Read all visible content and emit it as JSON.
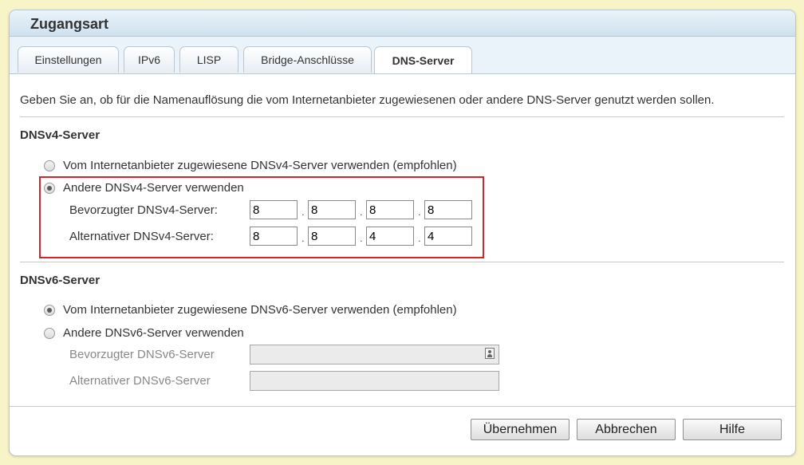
{
  "panel": {
    "title": "Zugangsart"
  },
  "tabs": [
    {
      "label": "Einstellungen",
      "active": false
    },
    {
      "label": "IPv6",
      "active": false
    },
    {
      "label": "LISP",
      "active": false
    },
    {
      "label": "Bridge-Anschlüsse",
      "active": false
    },
    {
      "label": "DNS-Server",
      "active": true
    }
  ],
  "intro": "Geben Sie an, ob für die Namenauflösung die vom Internetanbieter zugewiesenen oder andere DNS-Server genutzt werden sollen.",
  "dnsv4": {
    "title": "DNSv4-Server",
    "option_isp": "Vom Internetanbieter zugewiesene DNSv4-Server verwenden (empfohlen)",
    "option_other": "Andere DNSv4-Server verwenden",
    "selected": "other",
    "preferred_label": "Bevorzugter DNSv4-Server:",
    "alternate_label": "Alternativer DNSv4-Server:",
    "preferred": [
      "8",
      "8",
      "8",
      "8"
    ],
    "alternate": [
      "8",
      "8",
      "4",
      "4"
    ],
    "separator": "."
  },
  "dnsv6": {
    "title": "DNSv6-Server",
    "option_isp": "Vom Internetanbieter zugewiesene DNSv6-Server verwenden (empfohlen)",
    "option_other": "Andere DNSv6-Server verwenden",
    "selected": "isp",
    "preferred_label": "Bevorzugter DNSv6-Server",
    "alternate_label": "Alternativer DNSv6-Server",
    "preferred": "",
    "alternate": ""
  },
  "buttons": {
    "apply": "Übernehmen",
    "cancel": "Abbrechen",
    "help": "Hilfe"
  },
  "colors": {
    "highlight": "#d9232b",
    "header": "#cfe1ee"
  }
}
